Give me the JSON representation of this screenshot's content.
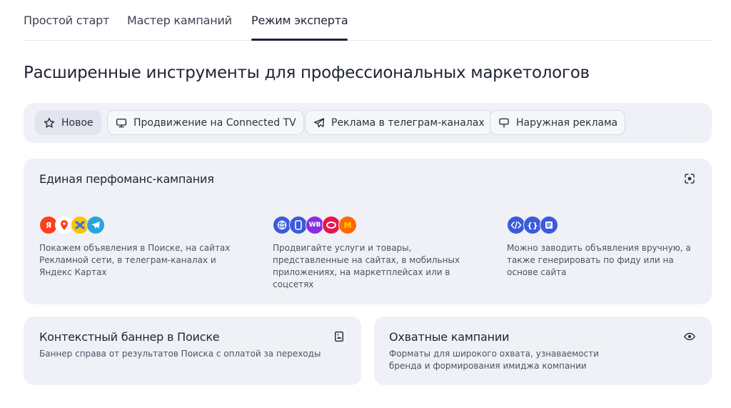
{
  "tabs": [
    {
      "label": "Простой старт"
    },
    {
      "label": "Мастер кампаний"
    },
    {
      "label": "Режим эксперта"
    }
  ],
  "page_title": "Расширенные инструменты для профессиональных маркетологов",
  "chips": [
    {
      "label": "Новое",
      "icon": "star-icon"
    },
    {
      "label": "Продвижение на Connected TV",
      "icon": "tv-icon"
    },
    {
      "label": "Реклама в телеграм-каналах",
      "icon": "paper-plane-icon"
    },
    {
      "label": "Наружная реклама",
      "icon": "billboard-icon"
    }
  ],
  "unified_card": {
    "title": "Единая перфоманс-кампания",
    "columns": [
      {
        "desc": "Покажем объявления в Поиске, на сайтах Рекламной сети, в телеграм-каналах и Яндекс Картах",
        "logos": [
          {
            "text": "Я",
            "color": "#fc3f1d"
          },
          {
            "text": "",
            "color": "#ffffff"
          },
          {
            "text": "",
            "color": "#3b6fe0"
          },
          {
            "text": "",
            "color": "#2aa3e0"
          }
        ]
      },
      {
        "desc": "Продвигайте услуги и товары, представленные на сайтах, в мобильных приложениях, на маркетплейсах или в соцсетях",
        "logos": [
          {
            "text": "",
            "color": "#3b5bdb"
          },
          {
            "text": "",
            "color": "#3b5bdb"
          },
          {
            "text": "WB",
            "color": "#8a2be2"
          },
          {
            "text": "",
            "color": "#e8174b"
          },
          {
            "text": "M",
            "color": "#ff6a00"
          }
        ]
      },
      {
        "desc": "Можно заводить объявления вручную, а также генерировать по фиду или на основе сайта",
        "logos": [
          {
            "text": "",
            "color": "#3b5bdb"
          },
          {
            "text": "{}",
            "color": "#3b5bdb"
          },
          {
            "text": "",
            "color": "#3b5bdb"
          }
        ]
      }
    ]
  },
  "banner_card": {
    "title": "Контекстный баннер в Поиске",
    "desc": "Баннер справа от результатов Поиска с оплатой за переходы"
  },
  "reach_card": {
    "title": "Охватные кампании",
    "desc": "Форматы для широкого охвата, узнаваемости бренда и формирования имиджа компании"
  }
}
